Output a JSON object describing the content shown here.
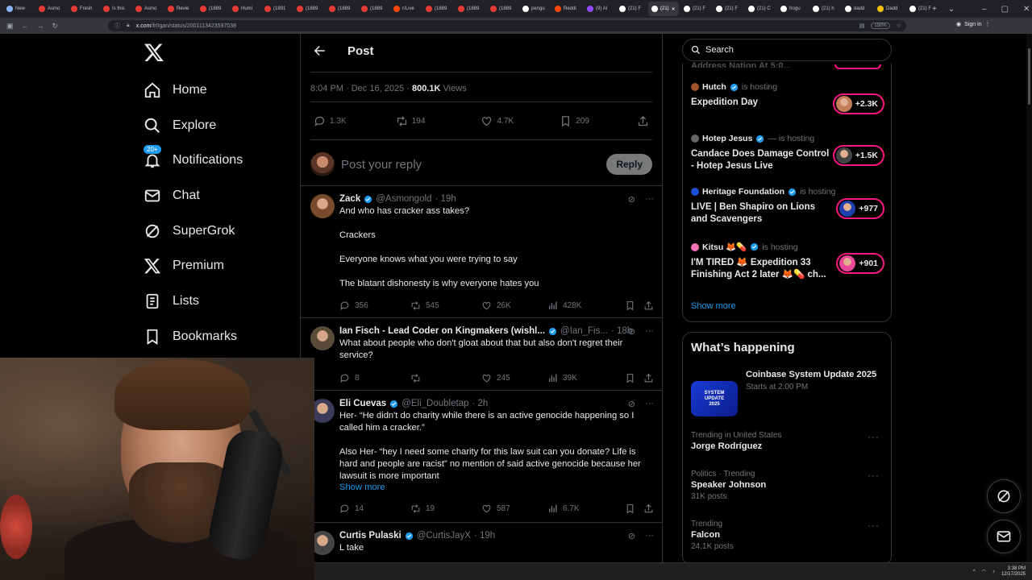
{
  "browser": {
    "tabs": [
      {
        "label": "New",
        "color": "#8ab4f8"
      },
      {
        "label": "Asmo",
        "color": "#e53935"
      },
      {
        "label": "Fresh",
        "color": "#e53935"
      },
      {
        "label": "Is this",
        "color": "#e53935"
      },
      {
        "label": "Asmo",
        "color": "#e53935"
      },
      {
        "label": "Revie",
        "color": "#e53935"
      },
      {
        "label": "(1889",
        "color": "#e53935"
      },
      {
        "label": "Humi",
        "color": "#e53935"
      },
      {
        "label": "(1891",
        "color": "#e53935"
      },
      {
        "label": "(1889",
        "color": "#e53935"
      },
      {
        "label": "(1889",
        "color": "#e53935"
      },
      {
        "label": "(1889",
        "color": "#e53935"
      },
      {
        "label": "r/Live",
        "color": "#ff4500"
      },
      {
        "label": "(1889",
        "color": "#e53935"
      },
      {
        "label": "(1889",
        "color": "#e53935"
      },
      {
        "label": "(1889",
        "color": "#e53935"
      },
      {
        "label": "pengu",
        "color": "#ffffff"
      },
      {
        "label": "Reddi",
        "color": "#ff4500"
      },
      {
        "label": "(9) AI",
        "color": "#9146ff"
      },
      {
        "label": "(21) F",
        "color": "#ffffff"
      },
      {
        "label": "(21)",
        "color": "#ffffff"
      },
      {
        "label": "(21) F",
        "color": "#ffffff"
      },
      {
        "label": "(21) F",
        "color": "#ffffff"
      },
      {
        "label": "(21) C",
        "color": "#ffffff"
      },
      {
        "label": "frogu",
        "color": "#ffffff"
      },
      {
        "label": "(21) h",
        "color": "#ffffff"
      },
      {
        "label": "dadd",
        "color": "#ffffff"
      },
      {
        "label": "Dadd",
        "color": "#f4c20d"
      },
      {
        "label": "(21) F",
        "color": "#ffffff"
      }
    ],
    "active_tab_index": 20,
    "url_host": "x.com",
    "url_path": "/fr0gan/status/2001113423597038",
    "zoom": "150%",
    "signin_label": "Sign in"
  },
  "sidebar": {
    "items": [
      {
        "label": "Home",
        "icon": "home-icon"
      },
      {
        "label": "Explore",
        "icon": "search-icon"
      },
      {
        "label": "Notifications",
        "icon": "bell-icon",
        "badge": "20+"
      },
      {
        "label": "Chat",
        "icon": "mail-icon"
      },
      {
        "label": "SuperGrok",
        "icon": "grok-icon"
      },
      {
        "label": "Premium",
        "icon": "x-logo-icon"
      },
      {
        "label": "Lists",
        "icon": "list-icon"
      },
      {
        "label": "Bookmarks",
        "icon": "bookmark-icon"
      }
    ]
  },
  "post": {
    "header_title": "Post",
    "time": "8:04 PM · Dec 16, 2025 · ",
    "views_count": "800.1K",
    "views_label": " Views",
    "stats": {
      "replies": "1.3K",
      "reposts": "194",
      "likes": "4.7K",
      "bookmarks": "209"
    },
    "reply_placeholder": "Post your reply",
    "reply_button": "Reply"
  },
  "replies": [
    {
      "name": "Zack",
      "handle": "@Asmongold",
      "time": "· 19h",
      "text": "And who has cracker ass takes?\n\nCrackers\n\nEveryone knows what you were trying to say\n\nThe blatant dishonesty is why everyone hates you",
      "show_more": "",
      "replies": "356",
      "reposts": "545",
      "likes": "26K",
      "views": "428K"
    },
    {
      "name": "Ian Fisch - Lead Coder on Kingmakers (wishl...",
      "handle": "@Ian_Fis...",
      "time": "· 18h",
      "text": "What about people who don't gloat about that but also don't regret their\nservice?",
      "show_more": "",
      "replies": "8",
      "reposts": "",
      "likes": "245",
      "views": "39K"
    },
    {
      "name": "Eli Cuevas",
      "handle": "@Eli_Doubletap",
      "time": "· 2h",
      "text": "Her- “He didn't do charity while there is an active genocide happening so I\ncalled him a cracker.”\n\nAlso Her- “hey I need some charity for this law suit can you donate? Life is\nhard and people are racist” no mention of said active genocide because her\nlawsuit is more important",
      "show_more": "Show more",
      "replies": "14",
      "reposts": "19",
      "likes": "587",
      "views": "6.7K"
    },
    {
      "name": "Curtis Pulaski",
      "handle": "@CurtisJayX",
      "time": "· 19h",
      "text": "L take",
      "show_more": "",
      "replies": "",
      "reposts": "",
      "likes": "",
      "views": ""
    }
  ],
  "right": {
    "search_placeholder": "Search",
    "truncated_title": "Address Nation At 5:0...",
    "live": [
      {
        "host": "Hutch",
        "status": "is hosting",
        "title": "Expedition Day",
        "count": "+2.3K",
        "host_color": "#a0522d",
        "avatar_color": "#c47c5a"
      },
      {
        "host": "Hotep Jesus",
        "status": "— is hosting",
        "title": "Candace Does Damage Control - Hotep Jesus Live",
        "count": "+1.5K",
        "host_color": "#666666",
        "avatar_color": "#444444"
      },
      {
        "host": "Heritage Foundation",
        "status": "is hosting",
        "title": "LIVE | Ben Shapiro on Lions and Scavengers",
        "count": "+977",
        "host_color": "#1d4ed8",
        "avatar_color": "#1e40af"
      },
      {
        "host": "Kitsu 🦊💊",
        "status": "is hosting",
        "title": "I'M TIRED 🦊 Expedition 33 Finishing Act 2 later 🦊💊 ch...",
        "count": "+901",
        "host_color": "#f472b6",
        "avatar_color": "#ec4899"
      }
    ],
    "show_more": "Show more",
    "happening_title": "What’s happening",
    "feature": {
      "title": "Coinbase System Update 2025",
      "subtitle": "Starts at 2:00 PM",
      "image_text_1": "SYSTEM",
      "image_text_2": "UPDATE",
      "image_text_3": "2025"
    },
    "trends": [
      {
        "context": "Trending in United States",
        "name": "Jorge Rodríguez",
        "count": ""
      },
      {
        "context": "Politics · Trending",
        "name": "Speaker Johnson",
        "count": "31K posts"
      },
      {
        "context": "Trending",
        "name": "Falcon",
        "count": "24.1K posts"
      }
    ]
  },
  "taskbar": {
    "time": "3:38 PM",
    "date": "12/17/2025"
  },
  "colors": {
    "accent": "#1d9bf0",
    "live_border": "#f91880",
    "background": "#000000",
    "muted": "#71767b"
  }
}
